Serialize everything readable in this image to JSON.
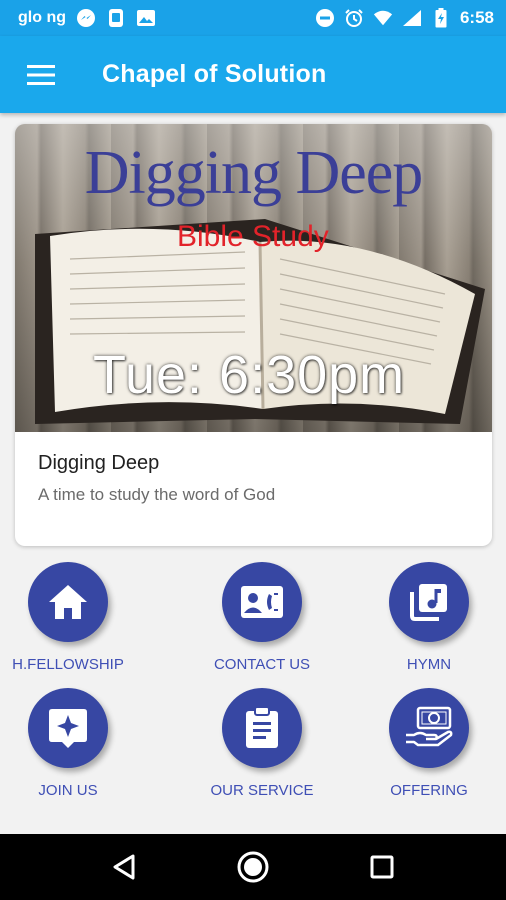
{
  "status_bar": {
    "carrier": "glo ng",
    "time": "6:58"
  },
  "app_bar": {
    "title": "Chapel of Solution"
  },
  "card": {
    "banner_title": "Digging Deep",
    "banner_subtitle": "Bible Study",
    "banner_time": "Tue: 6:30pm",
    "title": "Digging Deep",
    "description": "A time to study the word of God"
  },
  "menu_items": [
    {
      "label": "H.FELLOWSHIP",
      "icon": "home-icon"
    },
    {
      "label": "CONTACT US",
      "icon": "contact-card-icon"
    },
    {
      "label": "HYMN",
      "icon": "music-library-icon"
    },
    {
      "label": "JOIN US",
      "icon": "sparkle-chat-icon"
    },
    {
      "label": "OUR SERVICE",
      "icon": "clipboard-icon"
    },
    {
      "label": "OFFERING",
      "icon": "money-hand-icon"
    }
  ],
  "colors": {
    "status_bar": "#1aa2e8",
    "app_bar": "#1aa8ec",
    "icon_circle": "#3747a3",
    "label": "#3f4fb5",
    "banner_title": "#3b3f97",
    "banner_subtitle": "#e2232a"
  }
}
